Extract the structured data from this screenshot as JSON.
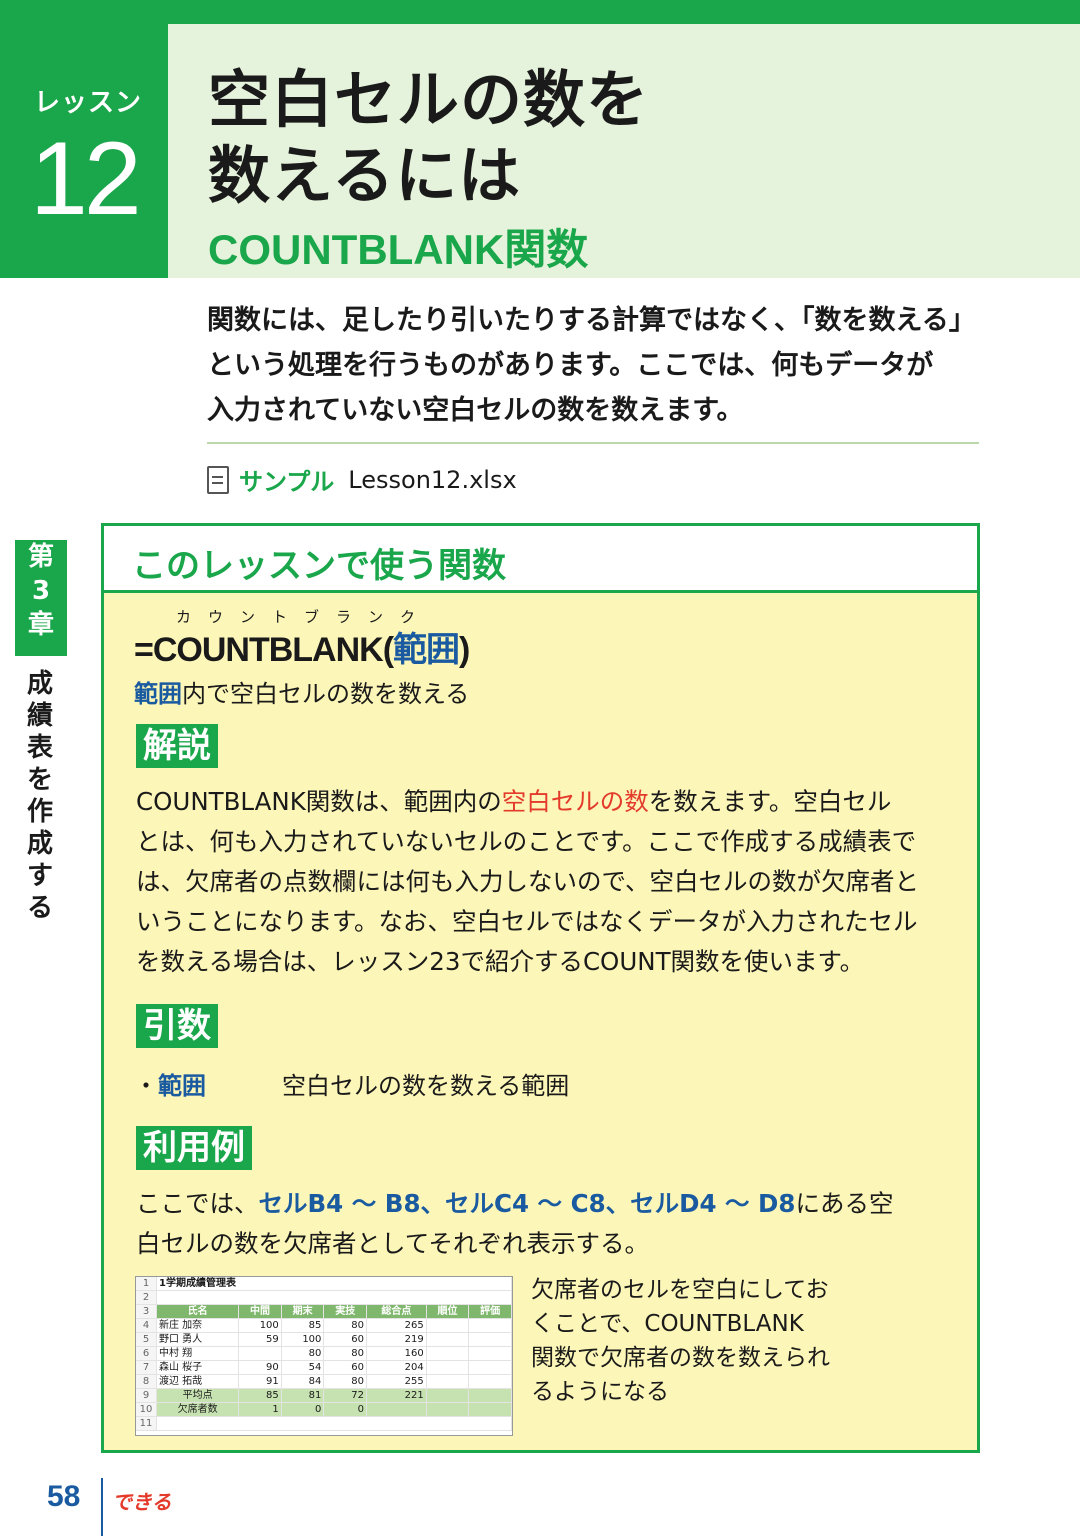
{
  "header": {
    "lesson_label": "レッスン",
    "lesson_number": "12",
    "title_line1": "空白セルの数を",
    "title_line2": "数えるには",
    "subtitle": "COUNTBLANK関数"
  },
  "intro": [
    "関数には、足したり引いたりする計算ではなく、「数を数える」",
    "という処理を行うものがあります。ここでは、何もデータが",
    "入力されていない空白セルの数を数えます。"
  ],
  "sample": {
    "label": "サンプル",
    "file": "Lesson12.xlsx"
  },
  "side": {
    "chapter": [
      "第",
      "3",
      "章"
    ],
    "title": [
      "成",
      "績",
      "表",
      "を",
      "作",
      "成",
      "す",
      "る"
    ]
  },
  "panel": {
    "heading": "このレッスンで使う関数",
    "ruby": "カウントブランク",
    "formula_prefix": "=COUNTBLANK(",
    "formula_arg": "範囲",
    "formula_suffix": ")",
    "desc_arg": "範囲",
    "desc_rest": "内で空白セルの数を数える",
    "kaisetsu_tag": "解説",
    "kaisetsu_l1_a": "COUNTBLANK関数は、範囲内の",
    "kaisetsu_l1_red": "空白セルの数",
    "kaisetsu_l1_b": "を数えます。空白セル",
    "kaisetsu_lines": [
      "とは、何も入力されていないセルのことです。ここで作成する成績表で",
      "は、欠席者の点数欄には何も入力しないので、空白セルの数が欠席者と",
      "いうことになります。なお、空白セルではなくデータが入力されたセル",
      "を数える場合は、レッスン23で紹介するCOUNT関数を使います。"
    ],
    "hikisu_tag": "引数",
    "arg_bullet": "・",
    "arg_name": "範囲",
    "arg_desc": "空白セルの数を数える範囲",
    "riyou_tag": "利用例",
    "riyou_a": "ここでは、",
    "riyou_b": "セルB4 ～ B8、セルC4 ～ C8、セルD4 ～ D8",
    "riyou_c": "にある空",
    "riyou_line2": "白セルの数を欠席者としてそれぞれ表示する。",
    "caption": [
      "欠席者のセルを空白にしてお",
      "くことで、COUNTBLANK",
      "関数で欠席者の数を数えられ",
      "るようになる"
    ]
  },
  "sheet": {
    "title": "1学期成績管理表",
    "headers": [
      "氏名",
      "中間",
      "期末",
      "実技",
      "総合点",
      "順位",
      "評価"
    ],
    "rows": [
      [
        "新庄 加奈",
        "100",
        "85",
        "80",
        "265",
        "",
        ""
      ],
      [
        "野口 勇人",
        "59",
        "100",
        "60",
        "219",
        "",
        ""
      ],
      [
        "中村 翔",
        "",
        "80",
        "80",
        "160",
        "",
        ""
      ],
      [
        "森山 桜子",
        "90",
        "54",
        "60",
        "204",
        "",
        ""
      ],
      [
        "渡辺 拓哉",
        "91",
        "84",
        "80",
        "255",
        "",
        ""
      ]
    ],
    "avg_row": [
      "平均点",
      "85",
      "81",
      "72",
      "221",
      "",
      ""
    ],
    "absent_row": [
      "欠席者数",
      "1",
      "0",
      "0",
      "",
      "",
      ""
    ],
    "row_numbers": [
      "1",
      "2",
      "3",
      "4",
      "5",
      "6",
      "7",
      "8",
      "9",
      "10",
      "11"
    ]
  },
  "footer": {
    "page": "58",
    "brand": "できる"
  },
  "colors": {
    "green": "#1aa64a",
    "light_green": "#e6f3dc",
    "panel_yellow": "#fcf6b8",
    "blue": "#1a5aa0",
    "red": "#e33a2b"
  }
}
